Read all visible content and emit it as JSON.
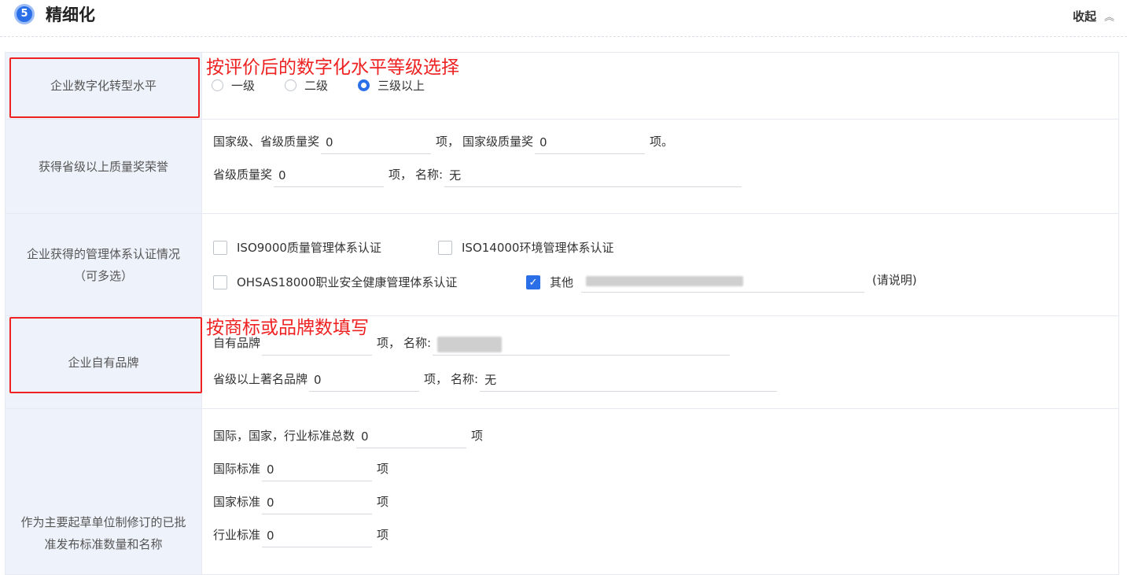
{
  "header": {
    "badge": "5",
    "title": "精细化",
    "collapse_label": "收起",
    "collapse_icon": "«"
  },
  "annotations": {
    "digital": "按评价后的数字化水平等级选择",
    "brand": "按商标或品牌数填写"
  },
  "digital_level": {
    "label": "企业数字化转型水平",
    "options": [
      "一级",
      "二级",
      "三级以上"
    ],
    "selected": "三级以上"
  },
  "quality_award": {
    "label": "获得省级以上质量奖荣誉",
    "line1_prefix": "国家级、省级质量奖",
    "line1_value": "0",
    "line1_unit": "项，",
    "national_label": "国家级质量奖",
    "national_value": "0",
    "national_unit": "项。",
    "provincial_label": "省级质量奖",
    "provincial_value": "0",
    "provincial_unit": "项，",
    "name_label": "名称:",
    "name_value": "无"
  },
  "certification": {
    "label": "企业获得的管理体系认证情况（可多选）",
    "options": [
      {
        "label": "ISO9000质量管理体系认证",
        "checked": false
      },
      {
        "label": "ISO14000环境管理体系认证",
        "checked": false
      },
      {
        "label": "OHSAS18000职业安全健康管理体系认证",
        "checked": false
      },
      {
        "label": "其他",
        "checked": true
      }
    ],
    "other_note": "(请说明)"
  },
  "brand": {
    "label": "企业自有品牌",
    "own_label": "自有品牌",
    "own_unit": "项，",
    "name_label": "名称:",
    "famous_label": "省级以上著名品牌",
    "famous_value": "0",
    "famous_unit": "项，",
    "famous_name_label": "名称:",
    "famous_name_value": "无"
  },
  "standards": {
    "label": "作为主要起草单位制修订的已批准发布标准数量和名称",
    "total_label": "国际，国家，行业标准总数",
    "total_value": "0",
    "total_unit": "项",
    "intl_label": "国际标准",
    "intl_value": "0",
    "intl_unit": "项",
    "national_label": "国家标准",
    "national_value": "0",
    "national_unit": "项",
    "industry_label": "行业标准",
    "industry_value": "0",
    "industry_unit": "项"
  }
}
